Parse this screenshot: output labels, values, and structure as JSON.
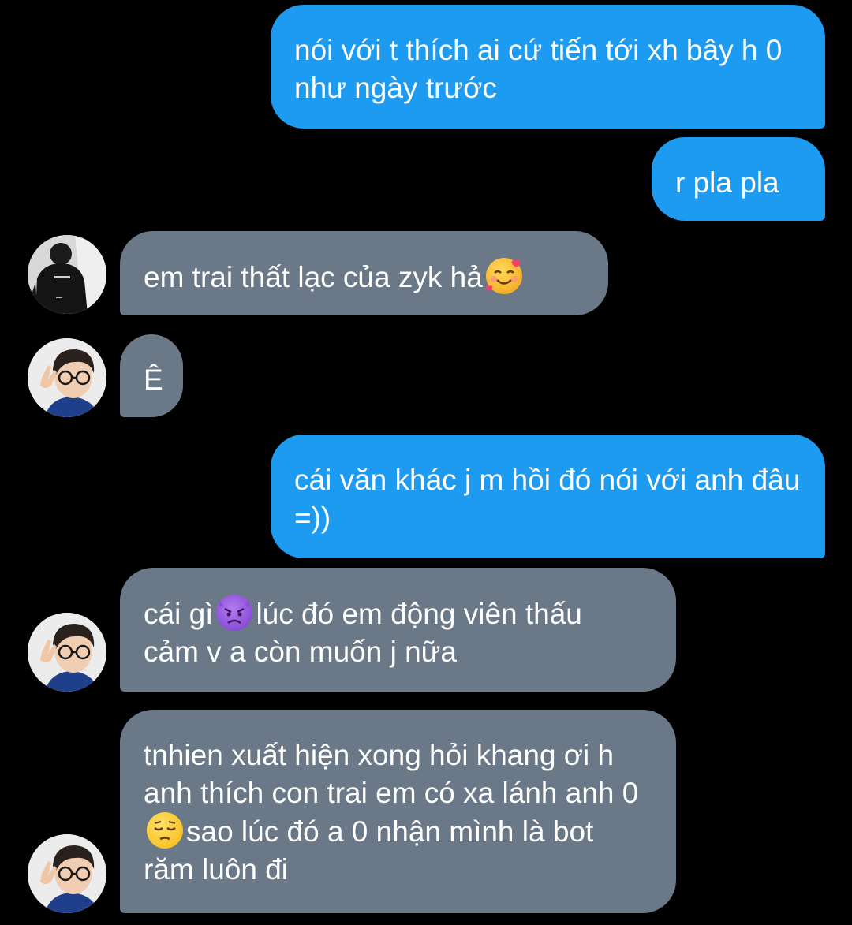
{
  "messages": [
    {
      "id": "m1",
      "side": "outgoing",
      "text": "nói với t thích ai cứ tiến tới xh bây h 0 như ngày trước"
    },
    {
      "id": "m2",
      "side": "outgoing",
      "text": "r pla pla"
    },
    {
      "id": "m3",
      "side": "incoming",
      "text": "em trai thất lạc của zyk hả",
      "emoji": "smiling-face-with-hearts"
    },
    {
      "id": "m4",
      "side": "incoming",
      "text": "Ê"
    },
    {
      "id": "m5",
      "side": "outgoing",
      "text": "cái văn khác j m hồi đó nói với anh đâu =))"
    },
    {
      "id": "m6",
      "side": "incoming",
      "text_before": "cái gì",
      "emoji": "angry-devil",
      "text_after": "lúc đó em động viên thấu cảm v a còn muốn j nữa"
    },
    {
      "id": "m7",
      "side": "incoming",
      "text_before": "tnhien xuất hiện xong hỏi khang ơi h anh thích con trai em có xa lánh anh 0",
      "emoji": "pensive-face",
      "text_after": "sao lúc đó a 0 nhận mình là bot răm luôn đi"
    }
  ],
  "avatars": [
    {
      "id": "a1",
      "kind": "photo-dark-jacket",
      "shirt_text": "CPOZHOO"
    },
    {
      "id": "a2",
      "kind": "photo-glasses-peace-sign"
    }
  ],
  "colors": {
    "background": "#000000",
    "outgoing_bubble": "#1d9bf0",
    "incoming_bubble": "#6b7887",
    "text": "#ffffff"
  }
}
